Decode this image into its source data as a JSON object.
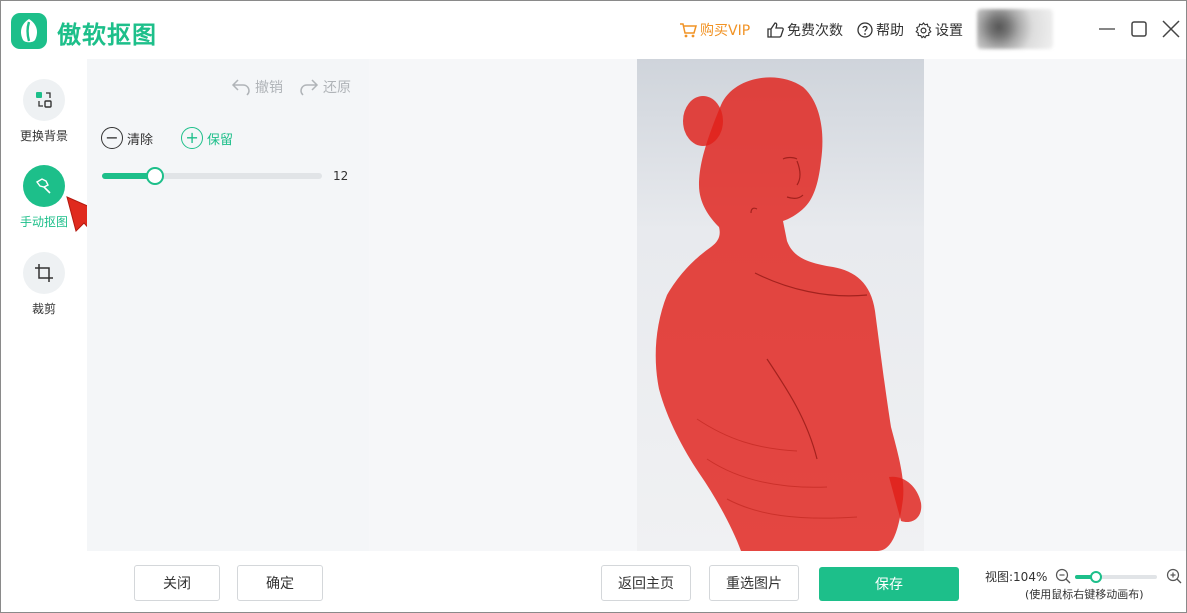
{
  "app": {
    "title": "傲软抠图",
    "accent_color": "#1dbf8a"
  },
  "header": {
    "buy_vip": "购买VIP",
    "free_count": "免费次数",
    "help": "帮助",
    "settings": "设置",
    "vip_color": "#f19325"
  },
  "rail": {
    "items": [
      {
        "label": "更换背景",
        "icon": "swap-background-icon",
        "active": false
      },
      {
        "label": "手动抠图",
        "icon": "manual-cutout-icon",
        "active": true
      },
      {
        "label": "裁剪",
        "icon": "crop-icon",
        "active": false
      }
    ]
  },
  "panel": {
    "undo": "撤销",
    "redo": "还原",
    "clear": "清除",
    "keep": "保留",
    "brush_size": 12,
    "brush_max": 50,
    "close": "关闭",
    "confirm": "确定"
  },
  "bottom": {
    "home": "返回主页",
    "reselect": "重选图片",
    "save": "保存",
    "zoom_label": "视图:104%",
    "zoom_fraction": 0.25,
    "zoom_hint": "(使用鼠标右键移动画布)"
  }
}
